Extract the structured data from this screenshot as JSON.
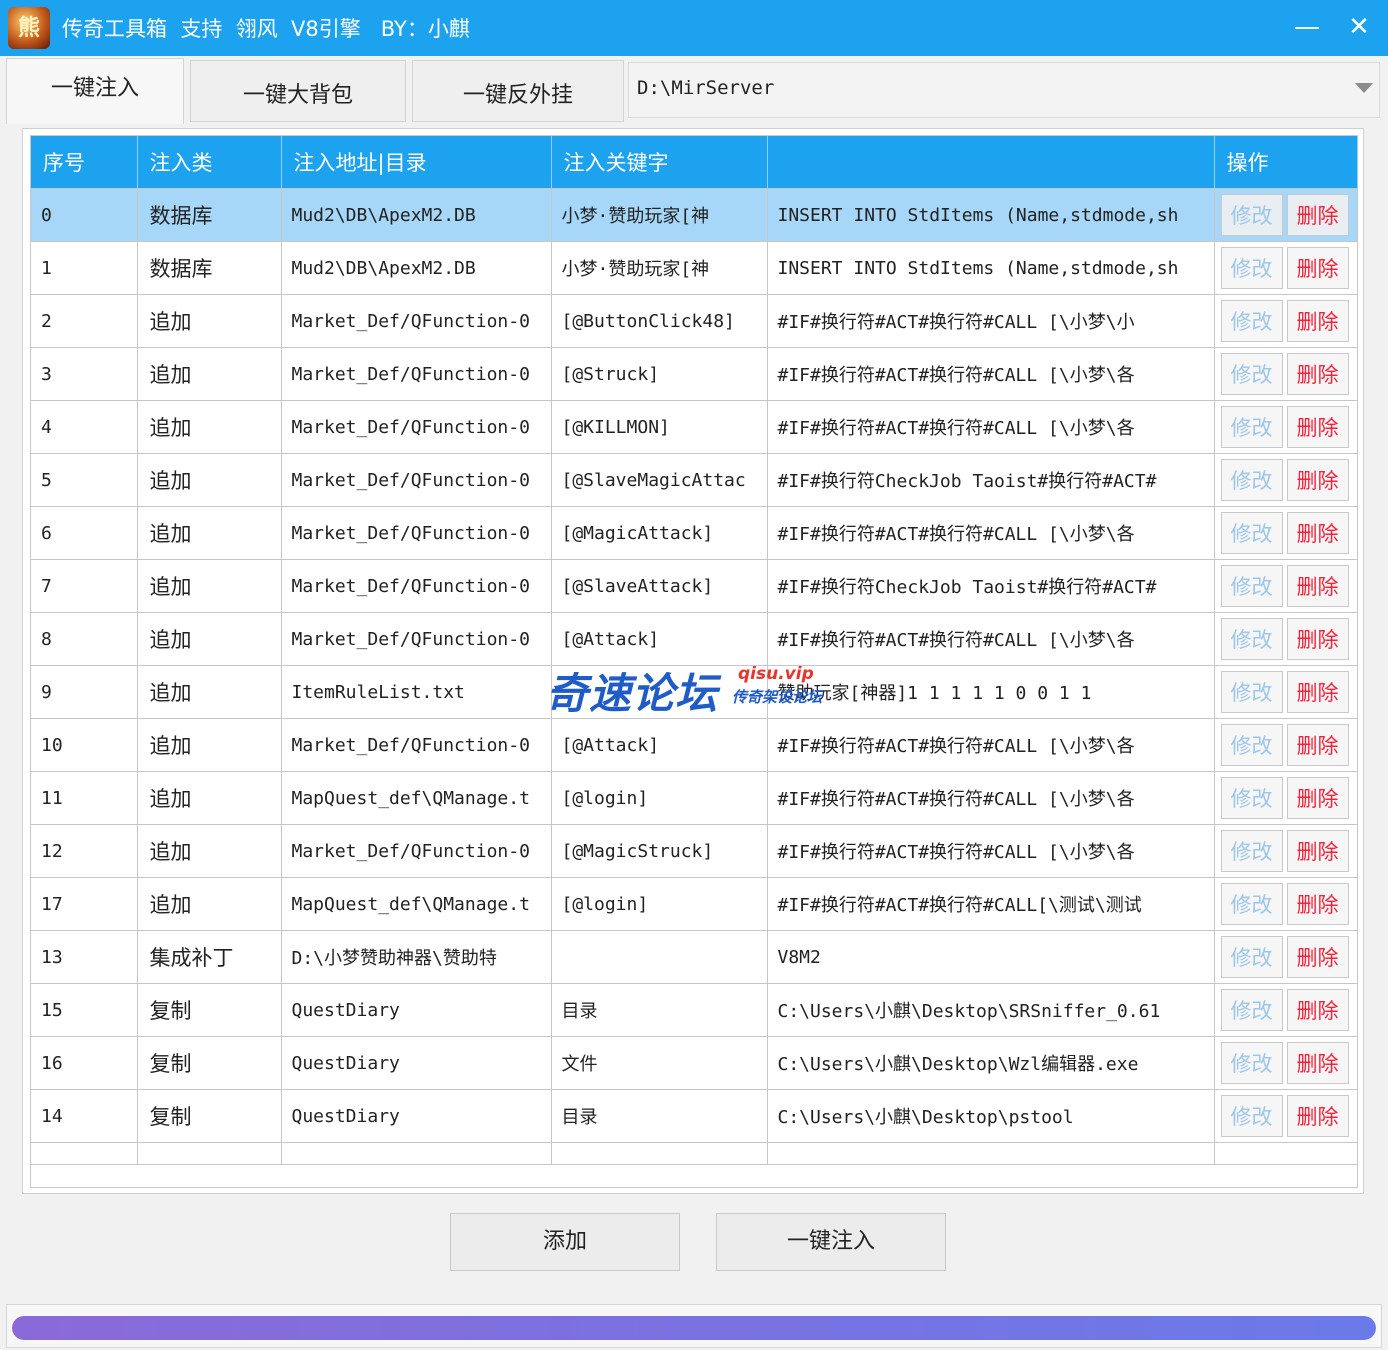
{
  "window": {
    "title": "传奇工具箱  支持  翎风  V8引擎   BY：小麒",
    "icon": "game-logo-icon",
    "icon_text": "熊",
    "minimize_glyph": "—",
    "close_glyph": "✕",
    "accent_color": "#1da2f0"
  },
  "tabs": [
    {
      "label": "一键注入",
      "active": true
    },
    {
      "label": "一键大背包",
      "active": false
    },
    {
      "label": "一键反外挂",
      "active": false
    }
  ],
  "server_path": {
    "value": "D:\\MirServer"
  },
  "table": {
    "headers": [
      "序号",
      "注入类",
      "注入地址|目录",
      "注入关键字",
      "",
      "操作"
    ],
    "edit_label": "修改",
    "delete_label": "删除",
    "rows": [
      {
        "no": "0",
        "type": "数据库",
        "target": "Mud2\\DB\\ApexM2.DB",
        "keyword": "小梦·赞助玩家[神",
        "content": "INSERT INTO StdItems (Name,stdmode,sh",
        "selected": true
      },
      {
        "no": "1",
        "type": "数据库",
        "target": "Mud2\\DB\\ApexM2.DB",
        "keyword": "小梦·赞助玩家[神",
        "content": "INSERT INTO StdItems (Name,stdmode,sh"
      },
      {
        "no": "2",
        "type": "追加",
        "target": "Market_Def/QFunction-0",
        "keyword": "[@ButtonClick48]",
        "content": "#IF#换行符#ACT#换行符#CALL [\\小梦\\小"
      },
      {
        "no": "3",
        "type": "追加",
        "target": "Market_Def/QFunction-0",
        "keyword": "[@Struck]",
        "content": "#IF#换行符#ACT#换行符#CALL [\\小梦\\各"
      },
      {
        "no": "4",
        "type": "追加",
        "target": "Market_Def/QFunction-0",
        "keyword": "[@KILLMON]",
        "content": "#IF#换行符#ACT#换行符#CALL [\\小梦\\各"
      },
      {
        "no": "5",
        "type": "追加",
        "target": "Market_Def/QFunction-0",
        "keyword": "[@SlaveMagicAttac",
        "content": "#IF#换行符CheckJob Taoist#换行符#ACT#"
      },
      {
        "no": "6",
        "type": "追加",
        "target": "Market_Def/QFunction-0",
        "keyword": "[@MagicAttack]",
        "content": "#IF#换行符#ACT#换行符#CALL [\\小梦\\各"
      },
      {
        "no": "7",
        "type": "追加",
        "target": "Market_Def/QFunction-0",
        "keyword": "[@SlaveAttack]",
        "content": "#IF#换行符CheckJob Taoist#换行符#ACT#"
      },
      {
        "no": "8",
        "type": "追加",
        "target": "Market_Def/QFunction-0",
        "keyword": "[@Attack]",
        "content": "#IF#换行符#ACT#换行符#CALL [\\小梦\\各"
      },
      {
        "no": "9",
        "type": "追加",
        "target": "ItemRuleList.txt",
        "keyword": "",
        "content": "赞助玩家[神器]1 1 1 1 1 0 0 1 1"
      },
      {
        "no": "10",
        "type": "追加",
        "target": "Market_Def/QFunction-0",
        "keyword": "[@Attack]",
        "content": "#IF#换行符#ACT#换行符#CALL [\\小梦\\各"
      },
      {
        "no": "11",
        "type": "追加",
        "target": "MapQuest_def\\QManage.t",
        "keyword": "[@login]",
        "content": "#IF#换行符#ACT#换行符#CALL [\\小梦\\各"
      },
      {
        "no": "12",
        "type": "追加",
        "target": "Market_Def/QFunction-0",
        "keyword": "[@MagicStruck]",
        "content": "#IF#换行符#ACT#换行符#CALL [\\小梦\\各"
      },
      {
        "no": "17",
        "type": "追加",
        "target": "MapQuest_def\\QManage.t",
        "keyword": "[@login]",
        "content": "#IF#换行符#ACT#换行符#CALL[\\测试\\测试"
      },
      {
        "no": "13",
        "type": "集成补丁",
        "target": "D:\\小梦赞助神器\\赞助特",
        "keyword": "",
        "content": "V8M2"
      },
      {
        "no": "15",
        "type": "复制",
        "target": "QuestDiary",
        "keyword": "目录",
        "content": "C:\\Users\\小麒\\Desktop\\SRSniffer_0.61"
      },
      {
        "no": "16",
        "type": "复制",
        "target": "QuestDiary",
        "keyword": "文件",
        "content": "C:\\Users\\小麒\\Desktop\\Wzl编辑器.exe"
      },
      {
        "no": "14",
        "type": "复制",
        "target": "QuestDiary",
        "keyword": "目录",
        "content": "C:\\Users\\小麒\\Desktop\\pstool"
      }
    ]
  },
  "buttons": {
    "add": "添加",
    "inject": "一键注入"
  },
  "progress": {
    "fraction": 1.0
  },
  "watermark": {
    "main": "奇速论坛",
    "url": "qisu.vip",
    "sub": "传奇架设论坛"
  }
}
